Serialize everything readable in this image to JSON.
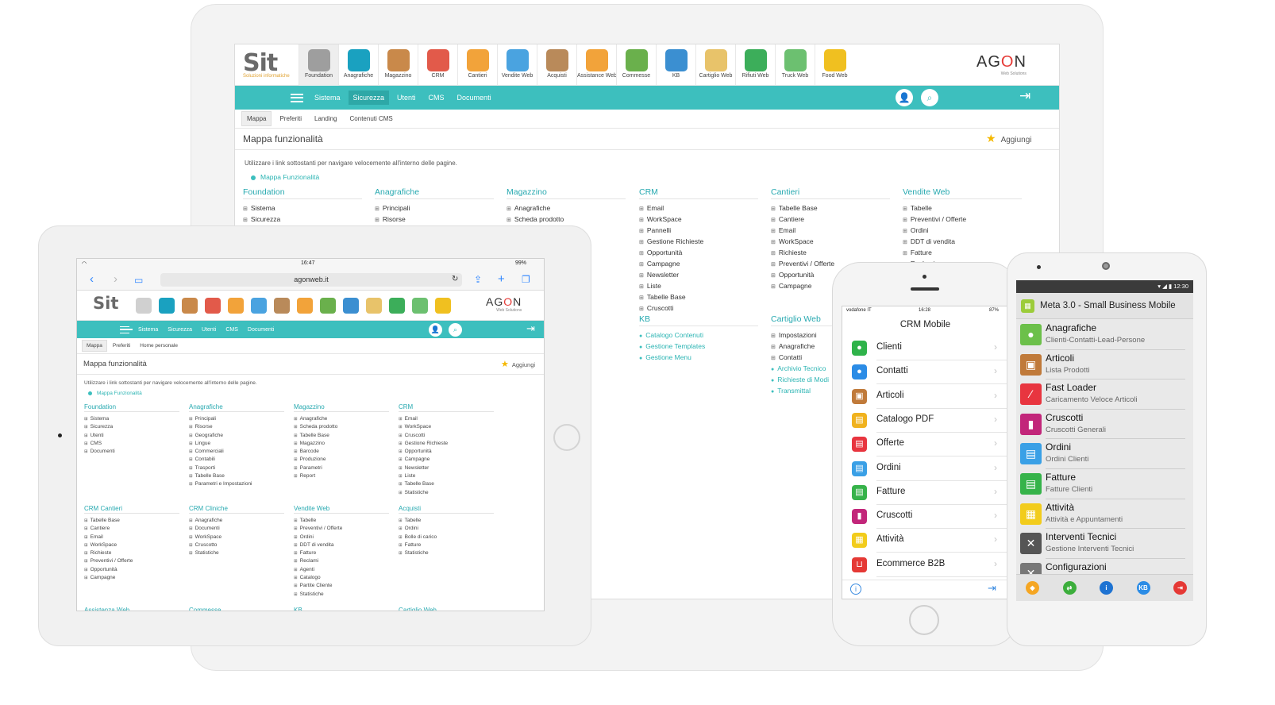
{
  "desktop": {
    "modules": [
      {
        "label": "Foundation",
        "icon": "gear-icon",
        "color": "#9e9e9e"
      },
      {
        "label": "Anagrafiche",
        "icon": "book-icon",
        "color": "#1aa1c0"
      },
      {
        "label": "Magazzino",
        "icon": "box-icon",
        "color": "#c9894a"
      },
      {
        "label": "CRM",
        "icon": "calendar-icon",
        "color": "#e25a4a"
      },
      {
        "label": "Cantieri",
        "icon": "clipboard-icon",
        "color": "#f2a33a"
      },
      {
        "label": "Vendite Web",
        "icon": "globe-cart-icon",
        "color": "#4aa3e0"
      },
      {
        "label": "Acquisti",
        "icon": "bag-icon",
        "color": "#b98a5a"
      },
      {
        "label": "Assistance Web",
        "icon": "support-icon",
        "color": "#f2a33a"
      },
      {
        "label": "Commesse",
        "icon": "clock-money-icon",
        "color": "#6ab04c"
      },
      {
        "label": "KB",
        "icon": "monitor-check-icon",
        "color": "#3b8fd1"
      },
      {
        "label": "Cartiglio Web",
        "icon": "document-icon",
        "color": "#e8c36a"
      },
      {
        "label": "Rifiuti Web",
        "icon": "recycle-icon",
        "color": "#3cae5a"
      },
      {
        "label": "Truck Web",
        "icon": "truck-box-icon",
        "color": "#6cc070"
      },
      {
        "label": "Food Web",
        "icon": "food-icon",
        "color": "#f0c020"
      }
    ],
    "brand": {
      "logo_text": "Sit",
      "logo_sub": "Soluzioni informatiche",
      "agon_a": "AG",
      "agon_o": "O",
      "agon_n": "N",
      "agon_sub": "Web Solutions"
    },
    "menu": [
      "Sistema",
      "Sicurezza",
      "Utenti",
      "CMS",
      "Documenti"
    ],
    "menu_active": "Sicurezza",
    "tabs": [
      "Mappa",
      "Preferiti",
      "Landing",
      "Contenuti CMS"
    ],
    "page_title": "Mappa funzionalità",
    "add_label": "Aggiungi",
    "hint": "Utilizzare i link sottostanti per navigare velocemente all'interno delle pagine.",
    "link": "Mappa Funzionalità",
    "columns": [
      {
        "title": "Foundation",
        "items": [
          "Sistema",
          "Sicurezza"
        ]
      },
      {
        "title": "Anagrafiche",
        "items": [
          "Principali",
          "Risorse"
        ]
      },
      {
        "title": "Magazzino",
        "items": [
          "Anagrafiche",
          "Scheda prodotto"
        ]
      },
      {
        "title": "CRM",
        "items": [
          "Email",
          "WorkSpace",
          "Pannelli",
          "Gestione Richieste",
          "Opportunità",
          "Campagne",
          "Newsletter",
          "Liste",
          "Tabelle Base",
          "Cruscotti"
        ]
      },
      {
        "title": "Cantieri",
        "items": [
          "Tabelle Base",
          "Cantiere",
          "Email",
          "WorkSpace",
          "Richieste",
          "Preventivi / Offerte",
          "Opportunità",
          "Campagne"
        ]
      },
      {
        "title": "Vendite Web",
        "items": [
          "Tabelle",
          "Preventivi / Offerte",
          "Ordini",
          "DDT di vendita",
          "Fatture",
          "Reclami"
        ]
      },
      {
        "title": "KB",
        "items": [
          "Catalogo Contenuti",
          "Gestione Templates",
          "Gestione Menu"
        ]
      },
      {
        "title": "Cartiglio Web",
        "items": [
          "Impostazioni",
          "Anagrafiche",
          "Contatti",
          "Archivio Tecnico",
          "Richieste di Modi",
          "Transmittal"
        ]
      }
    ]
  },
  "tablet": {
    "status_time": "16:47",
    "status_battery": "99%",
    "url": "agonweb.it",
    "menu": [
      "Sistema",
      "Sicurezza",
      "Utenti",
      "CMS",
      "Documenti"
    ],
    "tabs": [
      "Mappa",
      "Preferiti",
      "Home personale"
    ],
    "page_title": "Mappa funzionalità",
    "add_label": "Aggiungi",
    "hint": "Utilizzare i link sottostanti per navigare velocemente all'interno delle pagine.",
    "link": "Mappa Funzionalità",
    "columns": [
      {
        "title": "Foundation",
        "items": [
          "Sistema",
          "Sicurezza",
          "Utenti",
          "CMS",
          "Documenti"
        ]
      },
      {
        "title": "Anagrafiche",
        "items": [
          "Principali",
          "Risorse",
          "Geografiche",
          "Lingue",
          "Commerciali",
          "Contabili",
          "Trasporti",
          "Tabelle Base",
          "Parametri e Impostazioni"
        ]
      },
      {
        "title": "Magazzino",
        "items": [
          "Anagrafiche",
          "Scheda prodotto",
          "Tabelle Base",
          "Magazzino",
          "Barcode",
          "Produzione",
          "Parametri",
          "Report"
        ]
      },
      {
        "title": "CRM",
        "items": [
          "Email",
          "WorkSpace",
          "Cruscotti",
          "Gestione Richieste",
          "Opportunità",
          "Campagne",
          "Newsletter",
          "Liste",
          "Tabelle Base",
          "Statistiche"
        ]
      },
      {
        "title": "CRM Cantieri",
        "items": [
          "Tabelle Base",
          "Cantiere",
          "Email",
          "WorkSpace",
          "Richieste",
          "Preventivi / Offerte",
          "Opportunità",
          "Campagne"
        ]
      },
      {
        "title": "CRM Cliniche",
        "items": [
          "Anagrafiche",
          "Documenti",
          "WorkSpace",
          "Cruscotto",
          "Statistiche"
        ]
      },
      {
        "title": "Vendite Web",
        "items": [
          "Tabelle",
          "Preventivi / Offerte",
          "Ordini",
          "DDT di vendita",
          "Fatture",
          "Reclami",
          "Agenti",
          "Catalogo",
          "Partite Cliente",
          "Statistiche"
        ]
      },
      {
        "title": "Acquisti",
        "items": [
          "Tabelle",
          "Ordini",
          "Bolle di carico",
          "Fatture",
          "Statistiche"
        ]
      },
      {
        "title": "Assistenza Web",
        "items": []
      },
      {
        "title": "Commesse",
        "items": []
      },
      {
        "title": "KB",
        "items": []
      },
      {
        "title": "Cartiglio Web",
        "items": []
      }
    ]
  },
  "iphone": {
    "carrier": "vodafone IT",
    "time": "16:28",
    "battery": "87%",
    "title": "CRM Mobile",
    "items": [
      {
        "label": "Clienti",
        "color": "#2fb34a",
        "icon": "person-icon"
      },
      {
        "label": "Contatti",
        "color": "#2b8ce6",
        "icon": "person-icon"
      },
      {
        "label": "Articoli",
        "color": "#c07a3a",
        "icon": "box-icon"
      },
      {
        "label": "Catalogo PDF",
        "color": "#f0b21e",
        "icon": "book-icon"
      },
      {
        "label": "Offerte",
        "color": "#e8353f",
        "icon": "document-icon"
      },
      {
        "label": "Ordini",
        "color": "#3aa0e6",
        "icon": "document-icon"
      },
      {
        "label": "Fatture",
        "color": "#36b34a",
        "icon": "document-icon"
      },
      {
        "label": "Cruscotti",
        "color": "#c2267a",
        "icon": "chart-icon"
      },
      {
        "label": "Attività",
        "color": "#f2cc1c",
        "icon": "calendar-icon"
      },
      {
        "label": "Ecommerce B2B",
        "color": "#e53935",
        "icon": "cart-icon"
      }
    ]
  },
  "android": {
    "time": "12:30",
    "app_title": "Meta 3.0 - Small Business Mobile",
    "items": [
      {
        "title": "Anagrafiche",
        "subtitle": "Clienti-Contatti-Lead-Persone",
        "color": "#6cc04a",
        "icon": "people-icon"
      },
      {
        "title": "Articoli",
        "subtitle": "Lista Prodotti",
        "color": "#c07a3a",
        "icon": "box-icon"
      },
      {
        "title": "Fast Loader",
        "subtitle": "Caricamento Veloce Articoli",
        "color": "#e8353f",
        "icon": "wand-icon"
      },
      {
        "title": "Cruscotti",
        "subtitle": "Cruscotti Generali",
        "color": "#c2267a",
        "icon": "chart-icon"
      },
      {
        "title": "Ordini",
        "subtitle": "Ordini Clienti",
        "color": "#3aa0e6",
        "icon": "document-icon"
      },
      {
        "title": "Fatture",
        "subtitle": "Fatture Clienti",
        "color": "#36b34a",
        "icon": "document-icon"
      },
      {
        "title": "Attività",
        "subtitle": "Attività e Appuntamenti",
        "color": "#f2cc1c",
        "icon": "calendar-icon"
      },
      {
        "title": "Interventi Tecnici",
        "subtitle": "Gestione Interventi Tecnici",
        "color": "#555555",
        "icon": "toolbox-icon"
      },
      {
        "title": "Configurazioni",
        "subtitle": "",
        "color": "#777777",
        "icon": "wrench-icon"
      }
    ],
    "bottom": [
      {
        "icon": "bell-icon",
        "color": "#f5a623"
      },
      {
        "icon": "sync-icon",
        "color": "#3cae3c"
      },
      {
        "icon": "info-icon",
        "color": "#1e73d2"
      },
      {
        "icon": "kb-icon",
        "color": "#2b8ce6",
        "label": "KB"
      },
      {
        "icon": "logout-icon",
        "color": "#e53935"
      }
    ]
  }
}
